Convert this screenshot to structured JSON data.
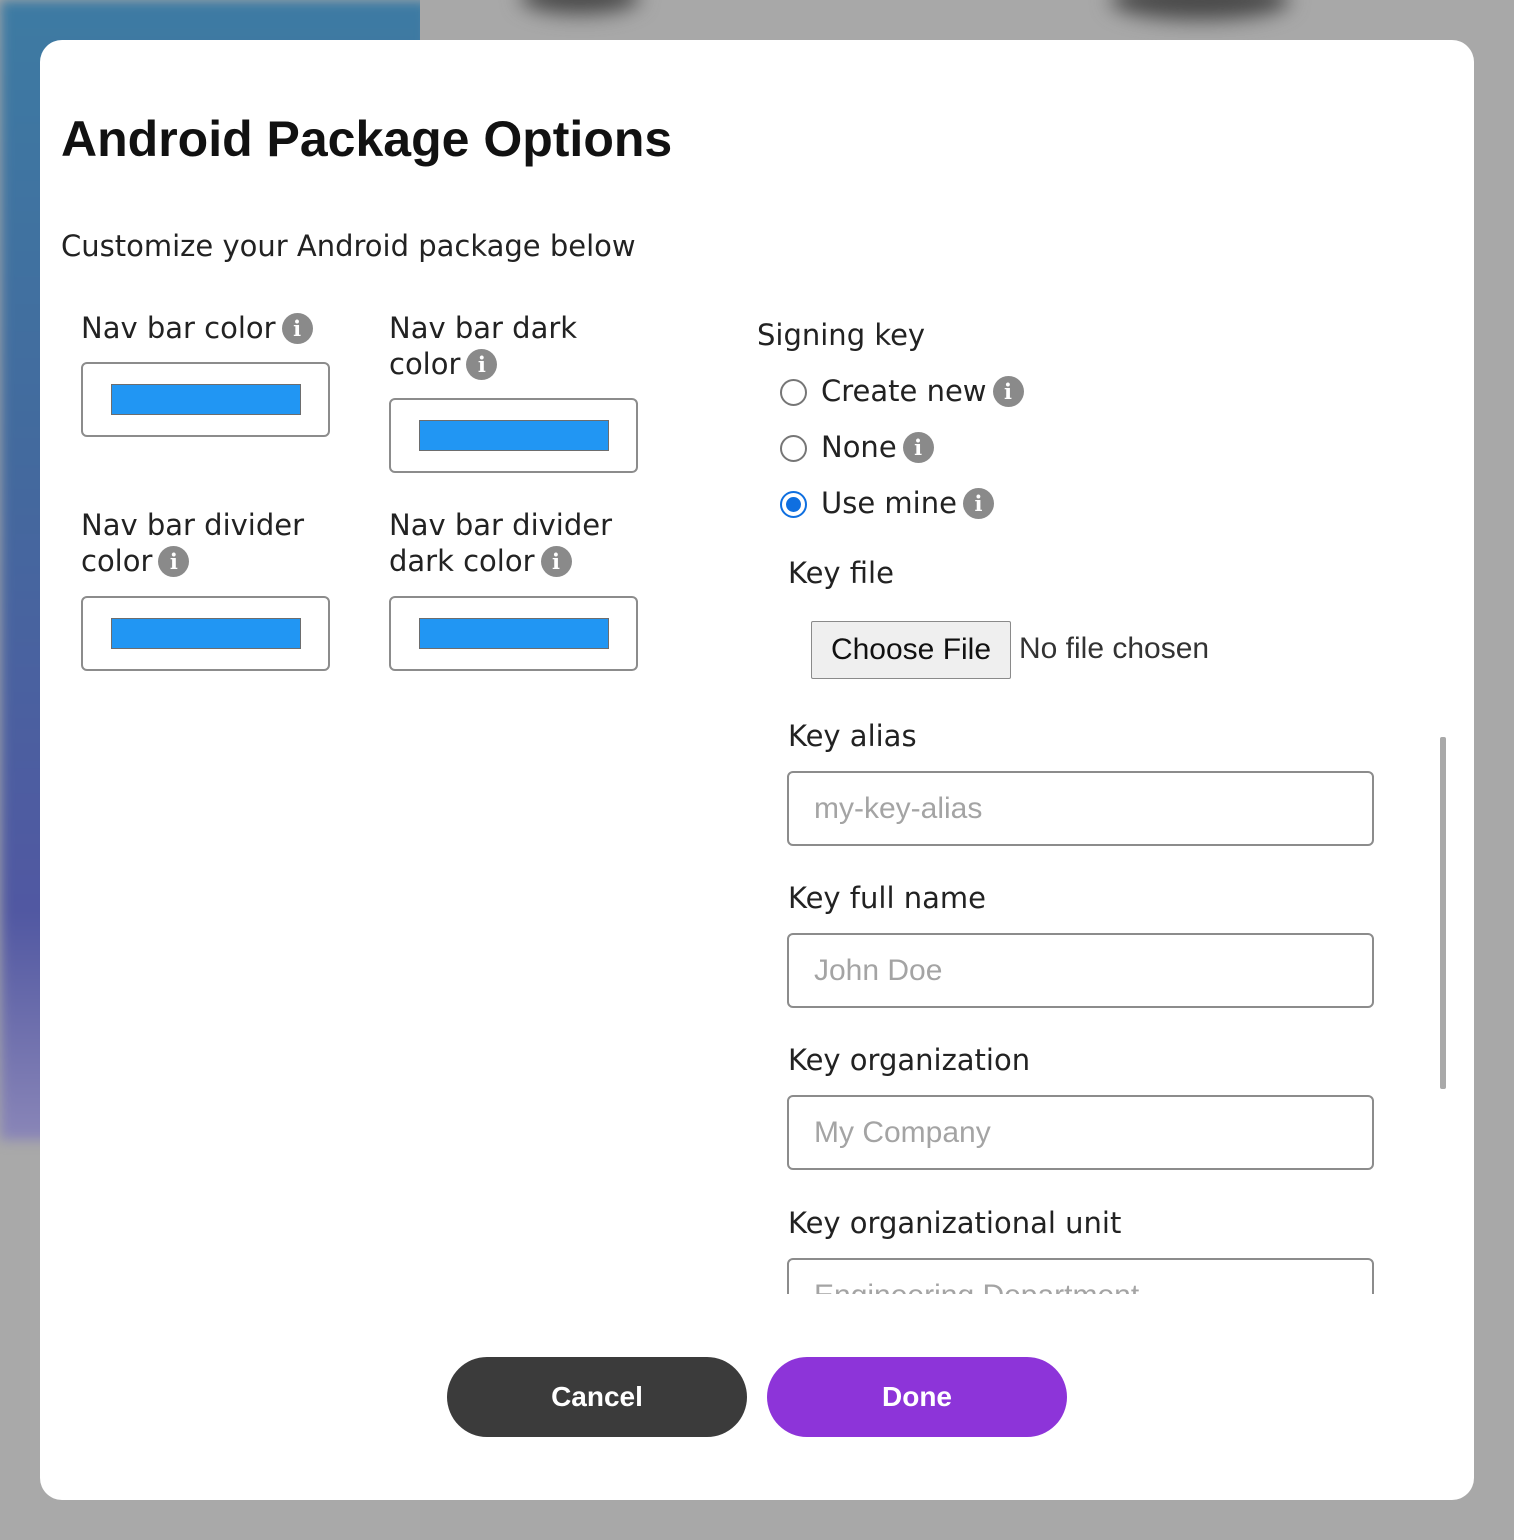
{
  "dialog": {
    "title": "Android Package Options",
    "subtitle": "Customize your Android package below"
  },
  "colors": {
    "accent": "#8d34d9",
    "swatch": "#2196f3",
    "radio_selected": "#0f6fe0"
  },
  "color_fields": [
    {
      "line1": "Nav bar color",
      "line2": "",
      "icon": "info-icon",
      "value": "#2196f3"
    },
    {
      "line1": "Nav bar dark",
      "line2": "color",
      "icon": "info-icon",
      "value": "#2196f3"
    },
    {
      "line1": "Nav bar divider",
      "line2": "color",
      "icon": "info-icon",
      "value": "#2196f3"
    },
    {
      "line1": "Nav bar divider",
      "line2": "dark color",
      "icon": "info-icon",
      "value": "#2196f3"
    }
  ],
  "info_glyph": "i",
  "signing": {
    "title": "Signing key",
    "options": [
      {
        "label": "Create new",
        "checked": false
      },
      {
        "label": "None",
        "checked": false
      },
      {
        "label": "Use mine",
        "checked": true
      }
    ],
    "key_file": {
      "label": "Key file",
      "button": "Choose File",
      "status": "No file chosen"
    },
    "fields": [
      {
        "label": "Key alias",
        "placeholder": "my-key-alias",
        "value": ""
      },
      {
        "label": "Key full name",
        "placeholder": "John Doe",
        "value": ""
      },
      {
        "label": "Key organization",
        "placeholder": "My Company",
        "value": ""
      },
      {
        "label": "Key organizational unit",
        "placeholder": "Engineering Department",
        "value": ""
      }
    ]
  },
  "footer": {
    "cancel": "Cancel",
    "done": "Done"
  }
}
